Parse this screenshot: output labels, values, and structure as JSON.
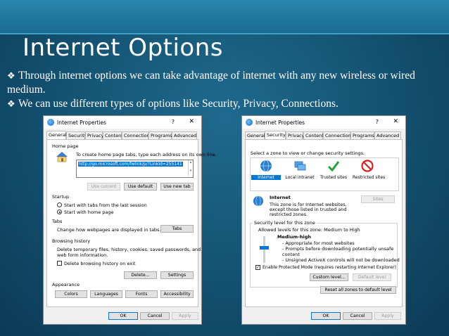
{
  "slide": {
    "title": "Internet Options",
    "bullet_1": "Through internet options we can take advantage of internet with any new wireless or wired medium.",
    "bullet_2": "We can use different types of options like Security, Privacy, Connections."
  },
  "colors": {
    "accent": "#0078d7",
    "background": "#13506f",
    "band": "#2b86ad"
  },
  "dialog_general": {
    "title": "Internet Properties",
    "help": "?",
    "close": "✕",
    "tabs": [
      "General",
      "Security",
      "Privacy",
      "Content",
      "Connections",
      "Programs",
      "Advanced"
    ],
    "home_page_heading": "Home page",
    "home_page_desc": "To create home page tabs, type each address on its own line.",
    "home_url": "http://go.microsoft.com/fwlink/p/?LinkId=255141",
    "use_current": "Use current",
    "use_default": "Use default",
    "use_new_tab": "Use new tab",
    "startup_heading": "Startup",
    "start_tabs_last": "Start with tabs from the last session",
    "start_home": "Start with home page",
    "tabs_heading": "Tabs",
    "tabs_desc": "Change how webpages are displayed in tabs.",
    "tabs_button": "Tabs",
    "browsing_heading": "Browsing history",
    "browsing_desc_1": "Delete temporary files, history, cookies, saved passwords, and",
    "browsing_desc_2": "web form information.",
    "delete_on_exit": "Delete browsing history on exit",
    "delete_button": "Delete...",
    "settings_button": "Settings",
    "appearance_heading": "Appearance",
    "colors_button": "Colors",
    "languages_button": "Languages",
    "fonts_button": "Fonts",
    "accessibility_button": "Accessibility",
    "ok": "OK",
    "cancel": "Cancel",
    "apply": "Apply"
  },
  "dialog_security": {
    "title": "Internet Properties",
    "help": "?",
    "close": "✕",
    "tabs": [
      "General",
      "Security",
      "Privacy",
      "Content",
      "Connections",
      "Programs",
      "Advanced"
    ],
    "select_zone": "Select a zone to view or change security settings.",
    "zones": [
      "Internet",
      "Local intranet",
      "Trusted sites",
      "Restricted sites"
    ],
    "zone_name": "Internet",
    "zone_desc_1": "This zone is for Internet websites,",
    "zone_desc_2": "except those listed in trusted and",
    "zone_desc_3": "restricted zones.",
    "sites_button": "Sites",
    "level_heading": "Security level for this zone",
    "allowed_levels": "Allowed levels for this zone: Medium to High",
    "level_name": "Medium-high",
    "level_item_1": "- Appropriate for most websites",
    "level_item_2": "- Prompts before downloading potentially unsafe",
    "level_item_3": "content",
    "level_item_4": "- Unsigned ActiveX controls will not be downloaded",
    "protected_mode": "Enable Protected Mode (requires restarting Internet Explorer)",
    "custom_level": "Custom level...",
    "default_level": "Default level",
    "reset_all": "Reset all zones to default level",
    "ok": "OK",
    "cancel": "Cancel",
    "apply": "Apply"
  }
}
